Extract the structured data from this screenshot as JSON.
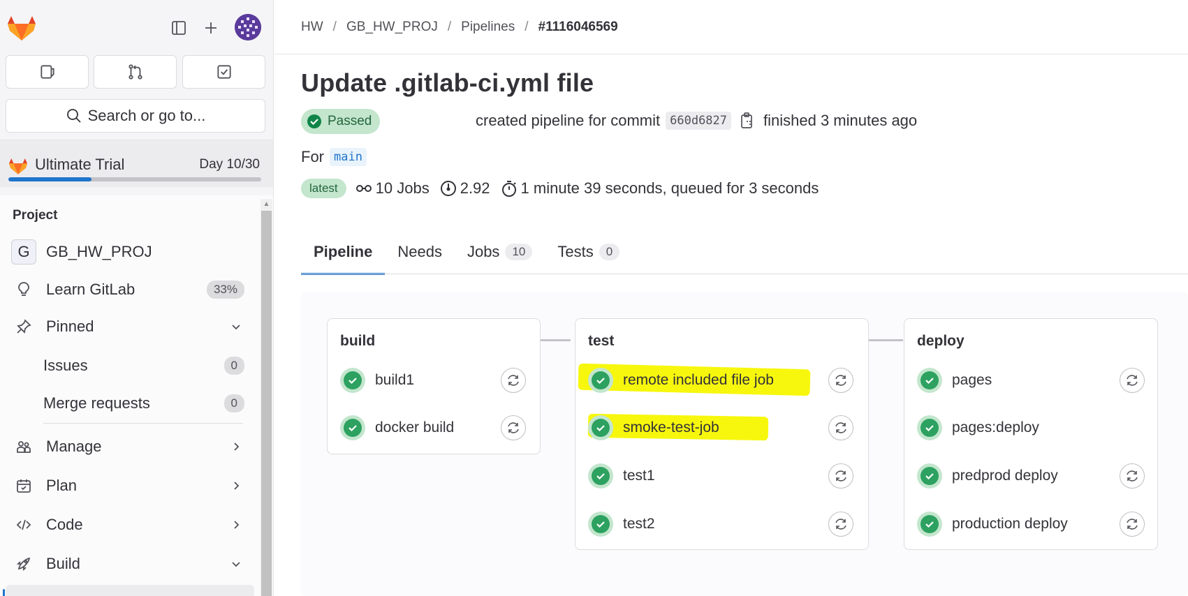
{
  "sidebar": {
    "search_label": "Search or go to...",
    "trial": {
      "name": "Ultimate Trial",
      "day": "Day 10/30",
      "progress_pct": 33
    },
    "section_heading": "Project",
    "project": {
      "letter": "G",
      "name": "GB_HW_PROJ"
    },
    "learn": {
      "label": "Learn GitLab",
      "percent": "33%"
    },
    "pinned": {
      "label": "Pinned"
    },
    "pinned_items": [
      {
        "label": "Issues",
        "count": "0"
      },
      {
        "label": "Merge requests",
        "count": "0"
      }
    ],
    "nav": [
      {
        "label": "Manage"
      },
      {
        "label": "Plan"
      },
      {
        "label": "Code"
      },
      {
        "label": "Build"
      }
    ]
  },
  "breadcrumb": [
    "HW",
    "GB_HW_PROJ",
    "Pipelines",
    "#1116046569"
  ],
  "pipeline": {
    "title": "Update .gitlab-ci.yml file",
    "status": "Passed",
    "created_text": "created pipeline for commit",
    "commit_sha": "660d6827",
    "finished_text": "finished 3 minutes ago",
    "for_text": "For",
    "branch": "main",
    "latest_badge": "latest",
    "jobs_count": "10 Jobs",
    "compute": "2.92",
    "duration": "1 minute 39 seconds, queued for 3 seconds"
  },
  "tabs": [
    {
      "label": "Pipeline",
      "count": null
    },
    {
      "label": "Needs",
      "count": null
    },
    {
      "label": "Jobs",
      "count": "10"
    },
    {
      "label": "Tests",
      "count": "0"
    }
  ],
  "stages": [
    {
      "name": "build",
      "jobs": [
        "build1",
        "docker build"
      ]
    },
    {
      "name": "test",
      "jobs": [
        "remote included file job",
        "smoke-test-job",
        "test1",
        "test2"
      ]
    },
    {
      "name": "deploy",
      "jobs": [
        "pages",
        "pages:deploy",
        "predprod deploy",
        "production deploy"
      ]
    }
  ],
  "colors": {
    "accent": "#1f75cb",
    "success": "#2da160",
    "success_bg": "#c3e6cd",
    "highlight": "#f7f700"
  }
}
